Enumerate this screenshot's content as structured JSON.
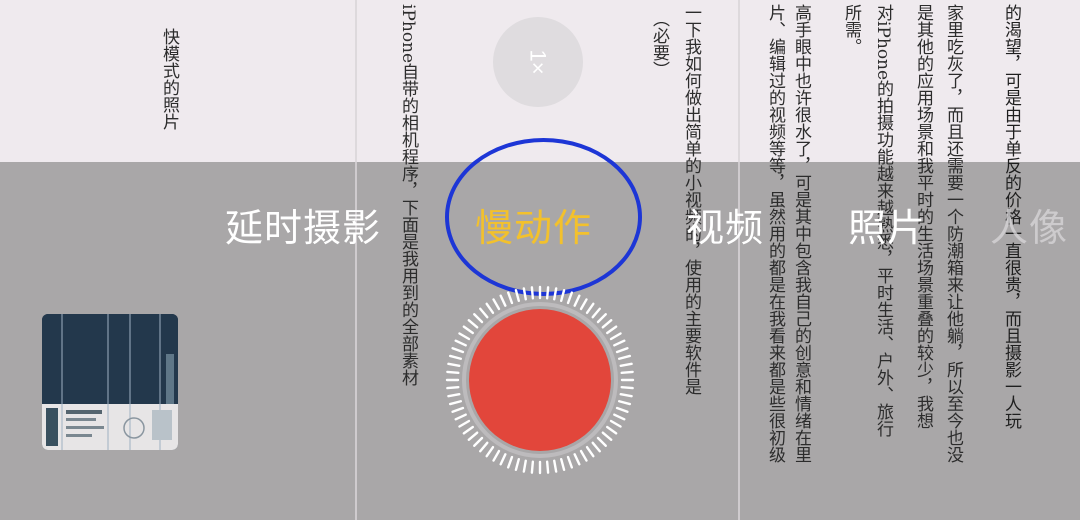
{
  "viewfinder": {
    "columns": [
      "快模式的照片",
      "iPhone自带的相机程序，下面是我用到的全部素材",
      "（必要）",
      "一下我如何做出简单的小视频的，使用的主要软件是",
      "片、编辑过的视频等等，虽然用的都是在我看来都是些很初级",
      "高手眼中也许很水了，可是其中包含我自己的创意和情绪在里",
      "所需。",
      "对iPhone的拍摄功能越来越熟悉，平时生活、户外、旅行",
      "是其他的应用场景和我平时的生活场景重叠的较少，我想",
      "家里吃灰了，而且还需要一个防潮箱来让他躺，所以至今也没",
      "的渴望，可是由于单反的价格一直很贵，而且摄影一人玩"
    ]
  },
  "zoom": {
    "label": "1×"
  },
  "modes": {
    "timelapse": "延时摄影",
    "slowmo": "慢动作",
    "video": "视频",
    "photo": "照片",
    "portrait": "人像"
  },
  "shutter": {
    "mode": "record",
    "color": "#e2463b"
  },
  "colors": {
    "active_mode": "#f3c12c",
    "annotation": "#1d36d6"
  }
}
